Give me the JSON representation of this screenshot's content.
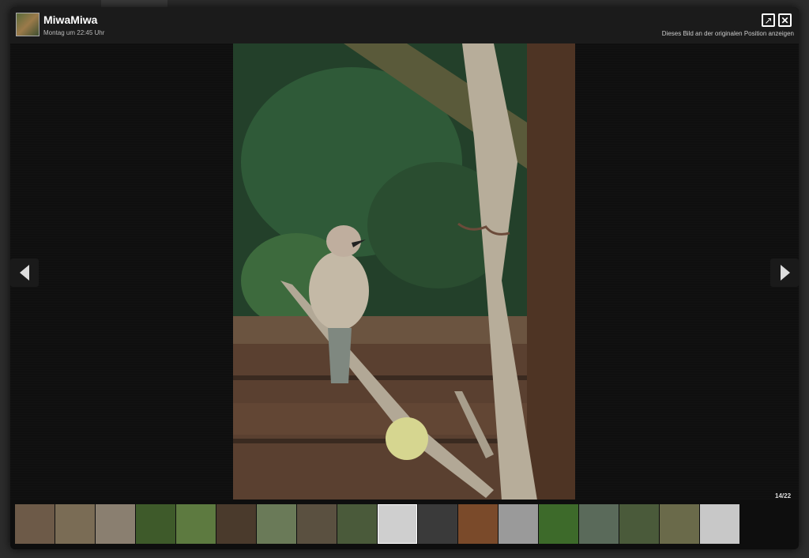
{
  "header": {
    "user_name": "MiwaMiwa",
    "post_time": "Montag um 22:45 Uhr",
    "show_original_label": "Dieses Bild an der originalen Position anzeigen"
  },
  "counter": "14/22",
  "icons": {
    "open_new": "external-link-icon",
    "close": "close-icon",
    "prev": "arrow-left-icon",
    "next": "arrow-right-icon"
  },
  "thumbnails": {
    "count_shown": 18,
    "active_index": 9,
    "colors": [
      "#6d5a48",
      "#7a6c55",
      "#8a7f70",
      "#3e5a2a",
      "#5d7a40",
      "#4a3a2c",
      "#6a7a58",
      "#5a5040",
      "#4a5a3a",
      "#cfcfcf",
      "#3a3a3a",
      "#7a4a2a",
      "#9a9a9a",
      "#3d6a2a",
      "#5a6a5a",
      "#4a5a3a",
      "#6a6a4a",
      "#c8c8c8"
    ]
  }
}
